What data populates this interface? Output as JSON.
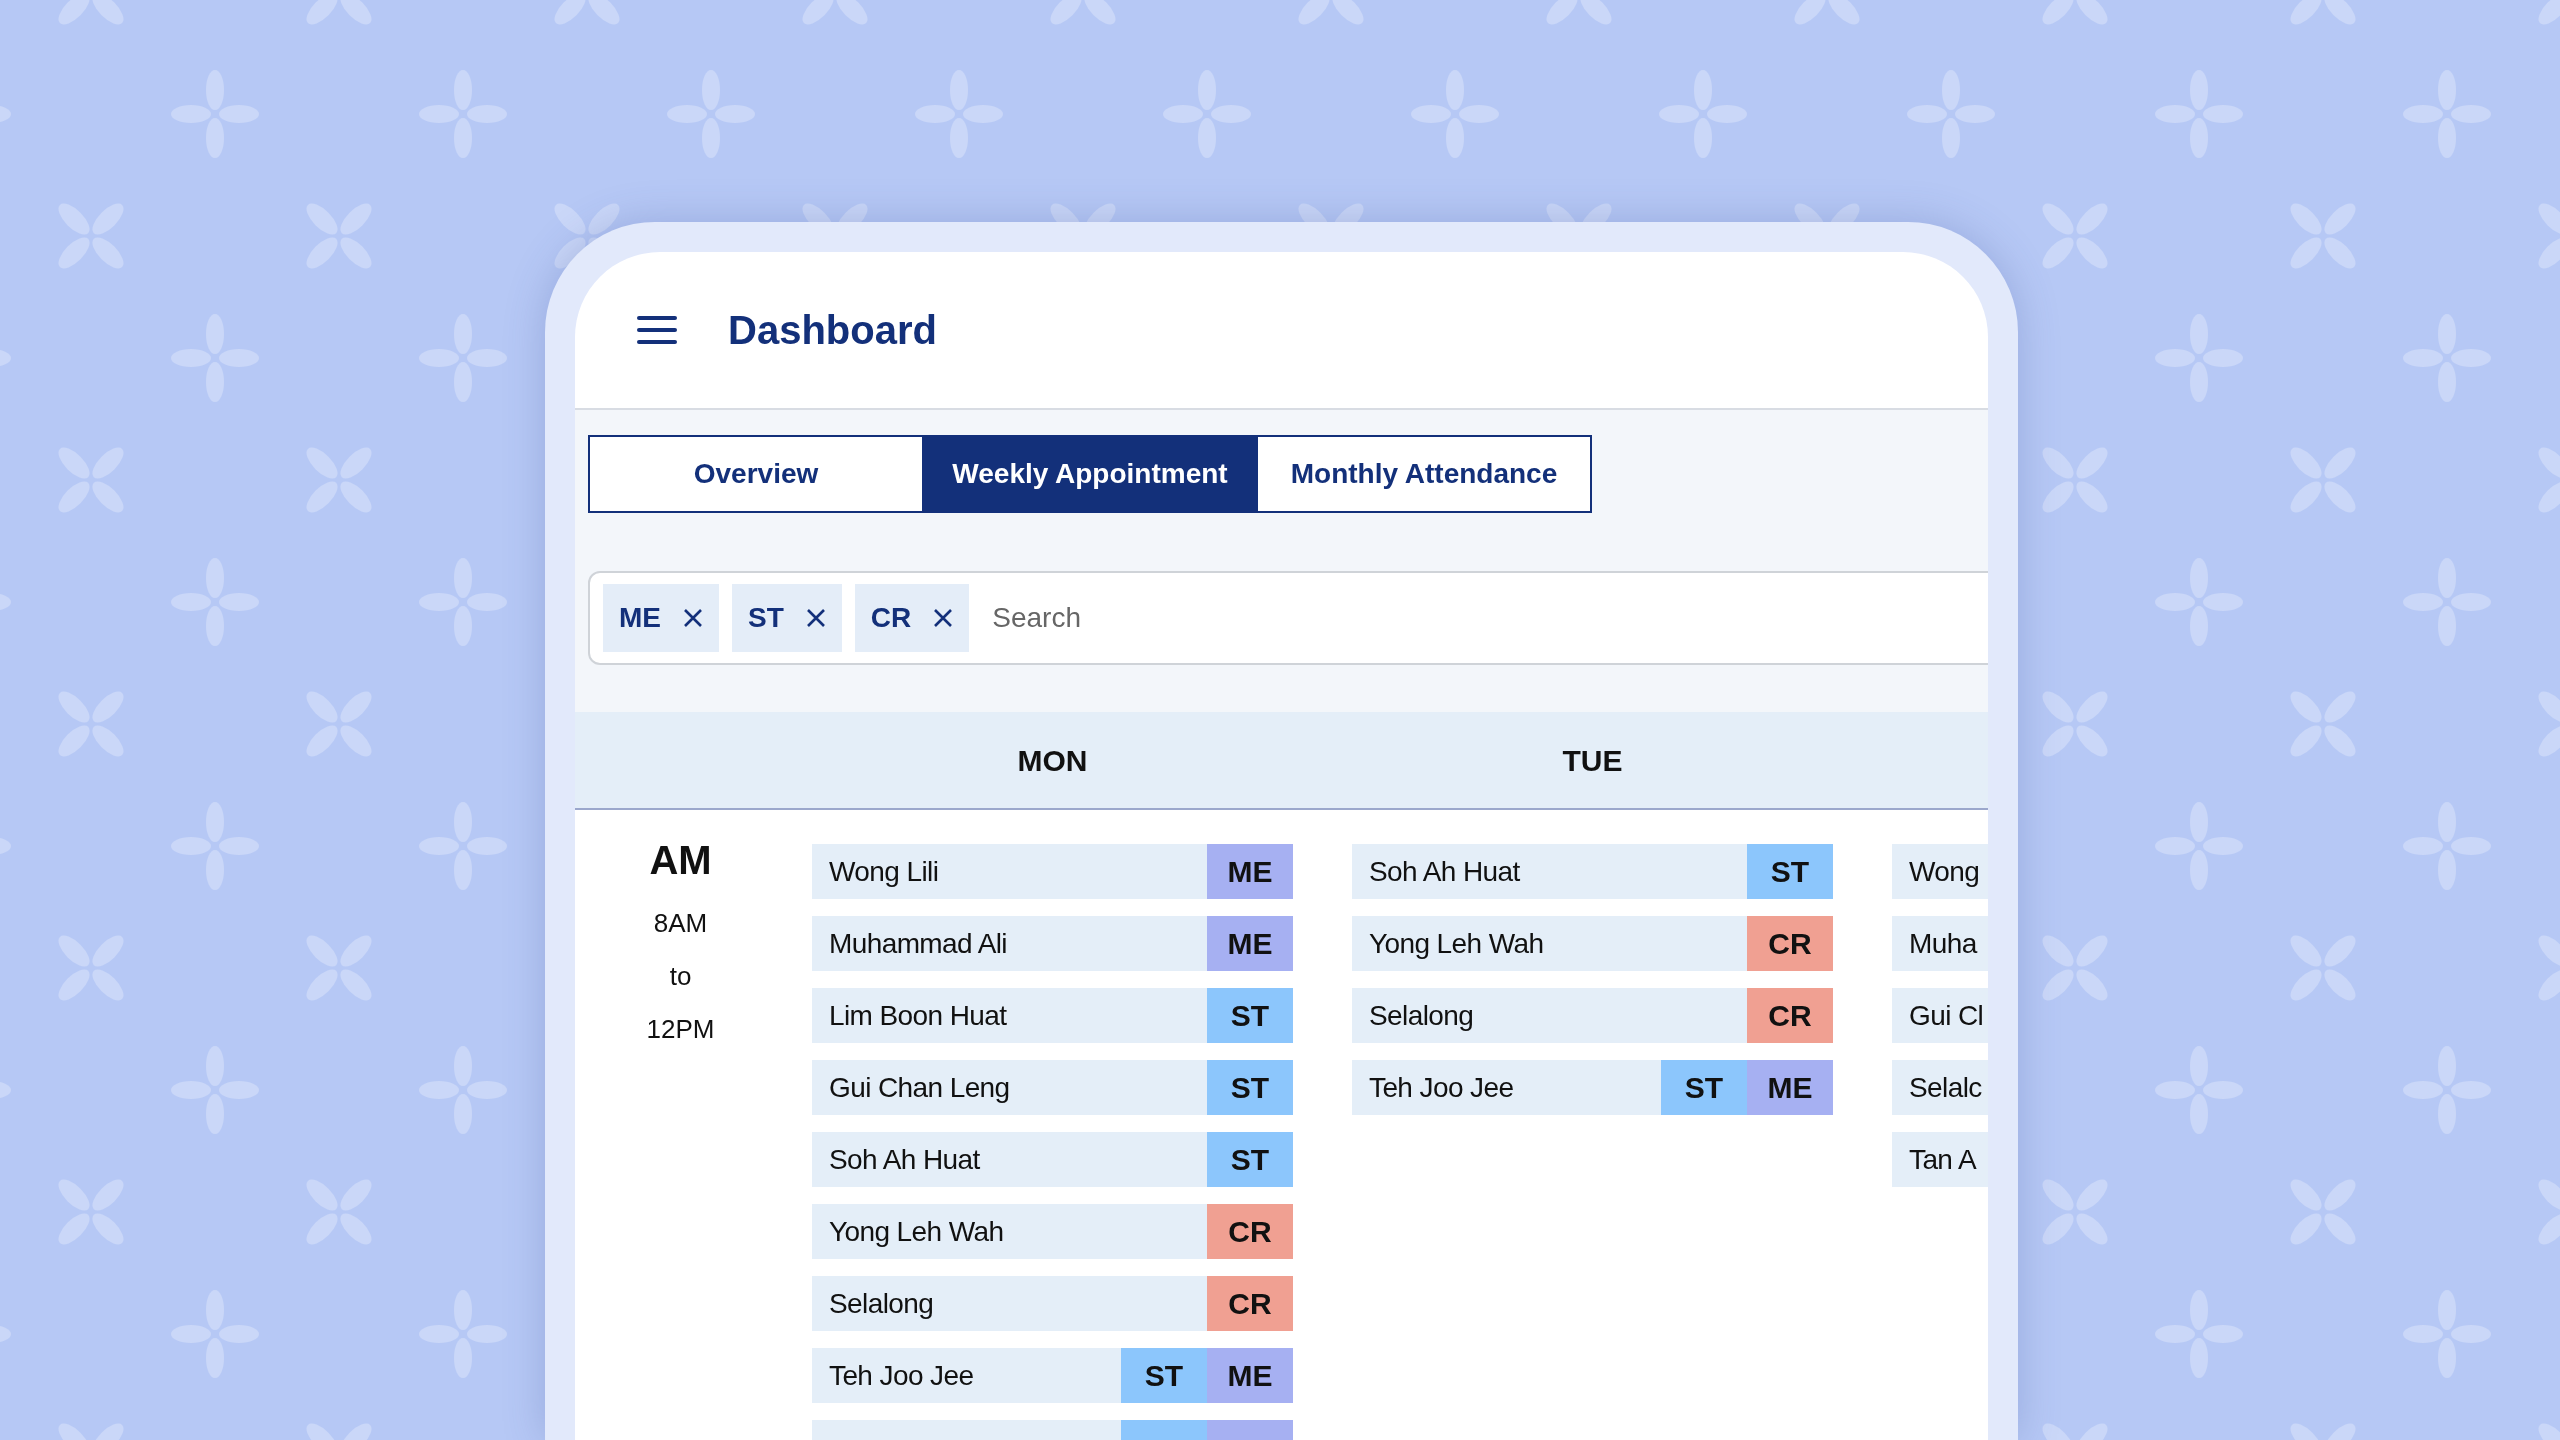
{
  "header": {
    "title": "Dashboard"
  },
  "tabs": [
    {
      "label": "Overview",
      "selected": false
    },
    {
      "label": "Weekly Appointment",
      "selected": true
    },
    {
      "label": "Monthly Attendance",
      "selected": false
    }
  ],
  "search": {
    "placeholder": "Search",
    "chips": [
      "ME",
      "ST",
      "CR"
    ]
  },
  "days": [
    "MON",
    "TUE"
  ],
  "period": {
    "label": "AM",
    "lines": [
      "8AM",
      "to",
      "12PM"
    ]
  },
  "columns": [
    {
      "rows": [
        {
          "name": "Wong Lili",
          "tags": [
            {
              "label": "ME",
              "color": "#a6b0f2"
            }
          ]
        },
        {
          "name": "Muhammad Ali",
          "tags": [
            {
              "label": "ME",
              "color": "#a6b0f2"
            }
          ]
        },
        {
          "name": "Lim Boon Huat",
          "tags": [
            {
              "label": "ST",
              "color": "#8cc6fc"
            }
          ]
        },
        {
          "name": "Gui Chan Leng",
          "tags": [
            {
              "label": "ST",
              "color": "#8cc6fc"
            }
          ]
        },
        {
          "name": "Soh Ah Huat",
          "tags": [
            {
              "label": "ST",
              "color": "#8cc6fc"
            }
          ]
        },
        {
          "name": "Yong Leh Wah",
          "tags": [
            {
              "label": "CR",
              "color": "#f0a092"
            }
          ]
        },
        {
          "name": "Selalong",
          "tags": [
            {
              "label": "CR",
              "color": "#f0a092"
            }
          ]
        },
        {
          "name": "Teh Joo Jee",
          "tags": [
            {
              "label": "ST",
              "color": "#8cc6fc"
            },
            {
              "label": "ME",
              "color": "#a6b0f2"
            }
          ]
        },
        {
          "tags": [
            {
              "color": "#8cc6fc"
            },
            {
              "color": "#a6b0f2"
            }
          ]
        }
      ]
    },
    {
      "rows": [
        {
          "name": "Soh Ah Huat",
          "tags": [
            {
              "label": "ST",
              "color": "#8cc6fc"
            }
          ]
        },
        {
          "name": "Yong Leh Wah",
          "tags": [
            {
              "label": "CR",
              "color": "#f0a092"
            }
          ]
        },
        {
          "name": "Selalong",
          "tags": [
            {
              "label": "CR",
              "color": "#f0a092"
            }
          ]
        },
        {
          "name": "Teh Joo Jee",
          "tags": [
            {
              "label": "ST",
              "color": "#8cc6fc"
            },
            {
              "label": "ME",
              "color": "#a6b0f2"
            }
          ]
        }
      ]
    },
    {
      "rows": [
        {
          "name": "Wong",
          "tags": []
        },
        {
          "name": "Muha",
          "tags": []
        },
        {
          "name": "Gui Cl",
          "tags": []
        },
        {
          "name": "Selalc",
          "tags": []
        },
        {
          "name": "Tan A",
          "tags": []
        }
      ]
    }
  ]
}
